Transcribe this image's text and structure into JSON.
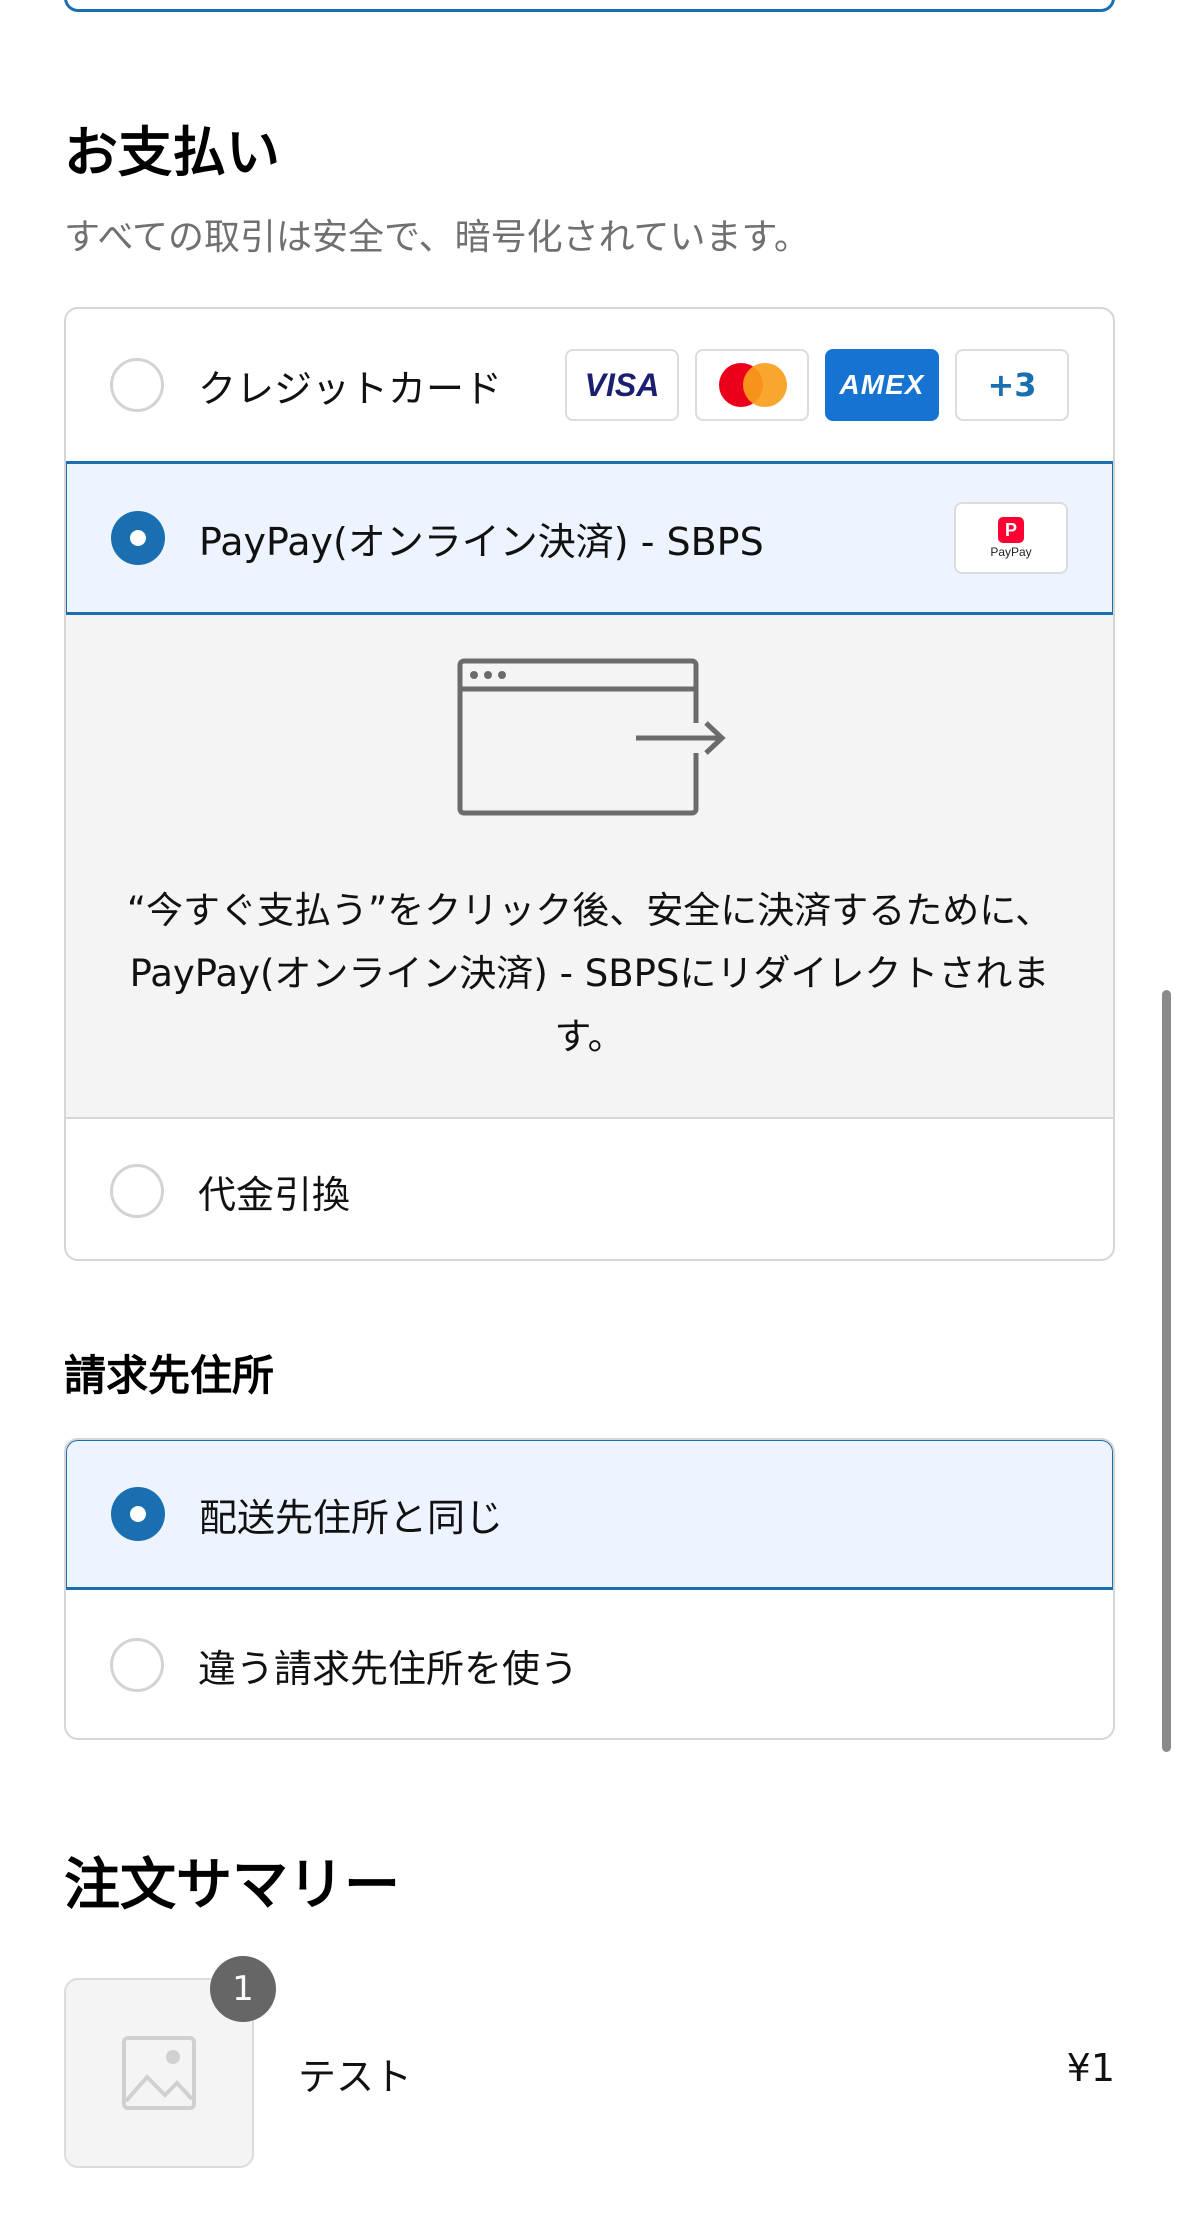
{
  "payment": {
    "heading": "お支払い",
    "subtitle": "すべての取引は安全で、暗号化されています。",
    "options": {
      "credit_card": {
        "label": "クレジットカード",
        "selected": false,
        "brands": {
          "visa": "VISA",
          "mastercard_icon": "mastercard-logo",
          "amex": "AMEX",
          "more": "+3"
        }
      },
      "paypay": {
        "label": "PayPay(オンライン決済) - SBPS",
        "selected": true,
        "logo_text": "PayPay",
        "logo_mark": "P",
        "redirect_icon": "browser-redirect-icon",
        "redirect_message": "“今すぐ支払う”をクリック後、安全に決済するために、PayPay(オンライン決済) - SBPSにリダイレクトされます。"
      },
      "cod": {
        "label": "代金引換",
        "selected": false
      }
    }
  },
  "billing": {
    "heading": "請求先住所",
    "options": {
      "same": {
        "label": "配送先住所と同じ",
        "selected": true
      },
      "different": {
        "label": "違う請求先住所を使う",
        "selected": false
      }
    }
  },
  "summary": {
    "heading": "注文サマリー",
    "items": [
      {
        "quantity": "1",
        "name": "テスト",
        "price": "¥1",
        "image_icon": "image-placeholder-icon"
      }
    ]
  },
  "colors": {
    "accent": "#1a6fb0",
    "selected_bg": "#eef4ff",
    "detail_bg": "#f4f4f4"
  }
}
